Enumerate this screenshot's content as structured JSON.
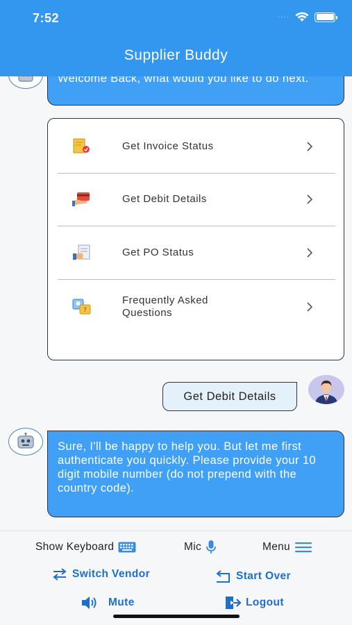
{
  "status_bar": {
    "time": "7:52",
    "signal": "····"
  },
  "header": {
    "title": "Supplier Buddy"
  },
  "chat": {
    "welcome_text": "Welcome Back, what would you like to do next.",
    "menu_items": [
      {
        "label": "Get Invoice Status",
        "icon": "invoice-icon"
      },
      {
        "label": "Get Debit Details",
        "icon": "debit-card-icon"
      },
      {
        "label": "Get PO Status",
        "icon": "po-document-icon"
      },
      {
        "label": "Frequently Asked Questions",
        "icon": "faq-icon"
      }
    ],
    "user_message": "Get Debit Details",
    "bot_reply": "Sure, I'll be happy to help you. But let me first authenticate you quickly. Please provide your 10 digit mobile number (do not prepend with the country code)."
  },
  "footer": {
    "show_keyboard": "Show Keyboard",
    "mic": "Mic",
    "menu": "Menu",
    "switch_vendor": "Switch Vendor",
    "start_over": "Start Over",
    "mute": "Mute",
    "logout": "Logout"
  },
  "colors": {
    "primary": "#3396ef",
    "bubble": "#40a0f5",
    "link": "#1d6fc9"
  }
}
